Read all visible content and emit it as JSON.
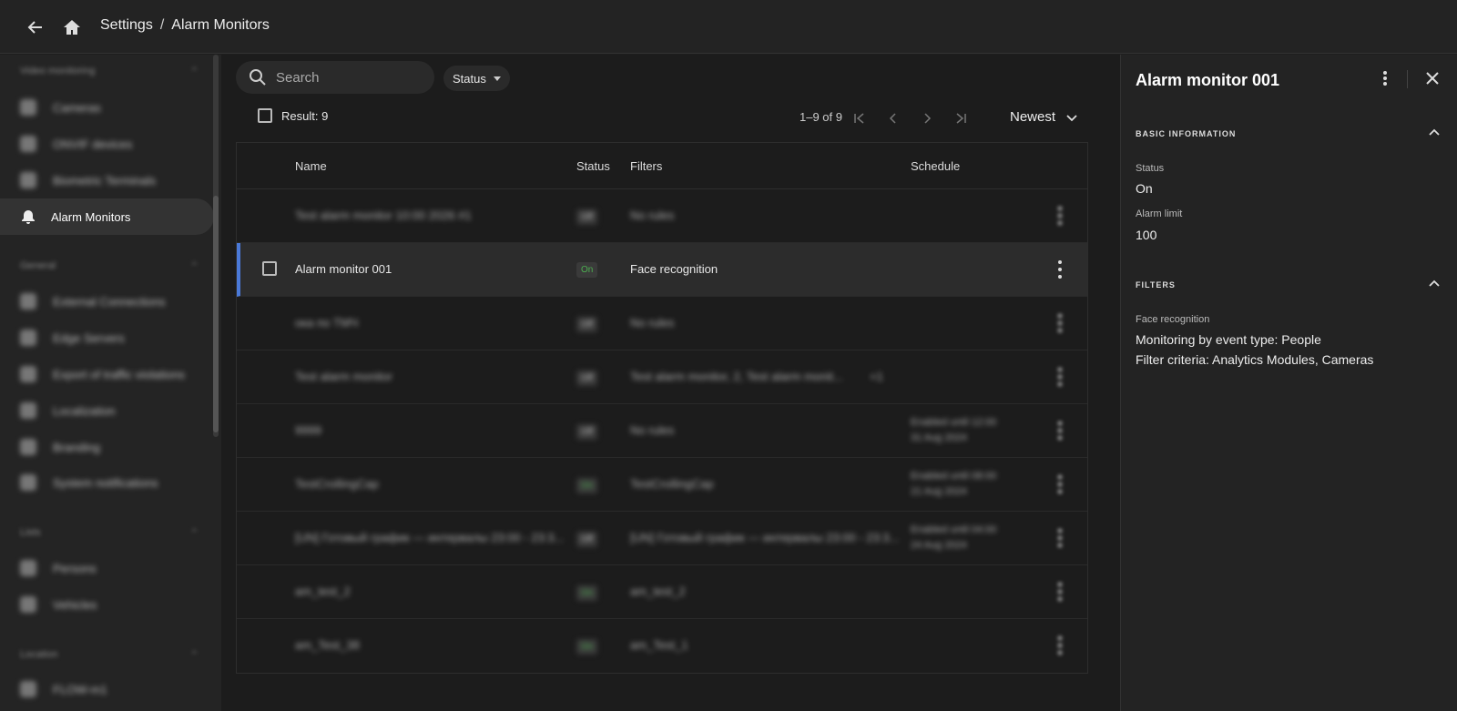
{
  "header": {
    "breadcrumb": [
      "Settings",
      "Alarm Monitors"
    ],
    "separator": "/"
  },
  "sidebar": {
    "sections": [
      {
        "title": "Video monitoring",
        "items": [
          "Cameras",
          "ONVIF devices",
          "Biometric Terminals"
        ]
      },
      {
        "title": "General",
        "items": [
          "External Connections",
          "Edge Servers",
          "Export of traffic violations",
          "Localization",
          "Branding",
          "System notifications"
        ]
      },
      {
        "title": "Lists",
        "items": [
          "Persons",
          "Vehicles"
        ]
      },
      {
        "title": "Location",
        "items": [
          "FLOW-m1"
        ]
      }
    ],
    "active_item": "Alarm Monitors"
  },
  "toolbar": {
    "search_placeholder": "Search",
    "status_filter": "Status",
    "result": "Result: 9",
    "pager": "1–9 of 9",
    "sort": "Newest"
  },
  "table": {
    "columns": [
      "Name",
      "Status",
      "Filters",
      "Schedule"
    ],
    "rows": [
      {
        "name": "Test alarm monitor 10:00 2026 #1",
        "status": "Off",
        "filters": "No rules",
        "schedule": "",
        "blurred": true
      },
      {
        "name": "Alarm monitor 001",
        "status": "On",
        "filters": "Face recognition",
        "schedule": "",
        "blurred": false
      },
      {
        "name": "ока по ТМЧ",
        "status": "Off",
        "filters": "No rules",
        "schedule": "",
        "blurred": true
      },
      {
        "name": "Test alarm monitor",
        "status": "Off",
        "filters": "Test alarm monitor, 2, Test alarm monit...",
        "extra": "+1",
        "schedule": "",
        "blurred": true
      },
      {
        "name": "9999",
        "status": "Off",
        "filters": "No rules",
        "schedule": "Enabled until 12:00\n31 Aug 2024",
        "blurred": true
      },
      {
        "name": "TestCrollingCap",
        "status": "On",
        "filters": "TestCrollingCap",
        "schedule": "Enabled until 08:00\n21 Aug 2024",
        "blurred": true
      },
      {
        "name": "[UN] Готовый график — интервалы 23:00 - 23:3...",
        "status": "Off",
        "filters": "[UN] Готовый график — интервалы 23:00 - 23:3...",
        "schedule": "Enabled until 04:00\n24 Aug 2024",
        "blurred": true
      },
      {
        "name": "am_test_2",
        "status": "On",
        "filters": "am_test_2",
        "schedule": "",
        "blurred": true
      },
      {
        "name": "am_Test_38",
        "status": "On",
        "filters": "am_Test_1",
        "schedule": "",
        "blurred": true
      }
    ]
  },
  "panel": {
    "title": "Alarm monitor 001",
    "basic_section": "BASIC INFORMATION",
    "status_label": "Status",
    "status_value": "On",
    "limit_label": "Alarm limit",
    "limit_value": "100",
    "filters_section": "FILTERS",
    "filter_label": "Face recognition",
    "filter_line1": "Monitoring by event type: People",
    "filter_line2": "Filter criteria: Analytics Modules, Cameras"
  },
  "colors": {
    "accent": "#4a79d8",
    "status_on": "#4caf50"
  }
}
